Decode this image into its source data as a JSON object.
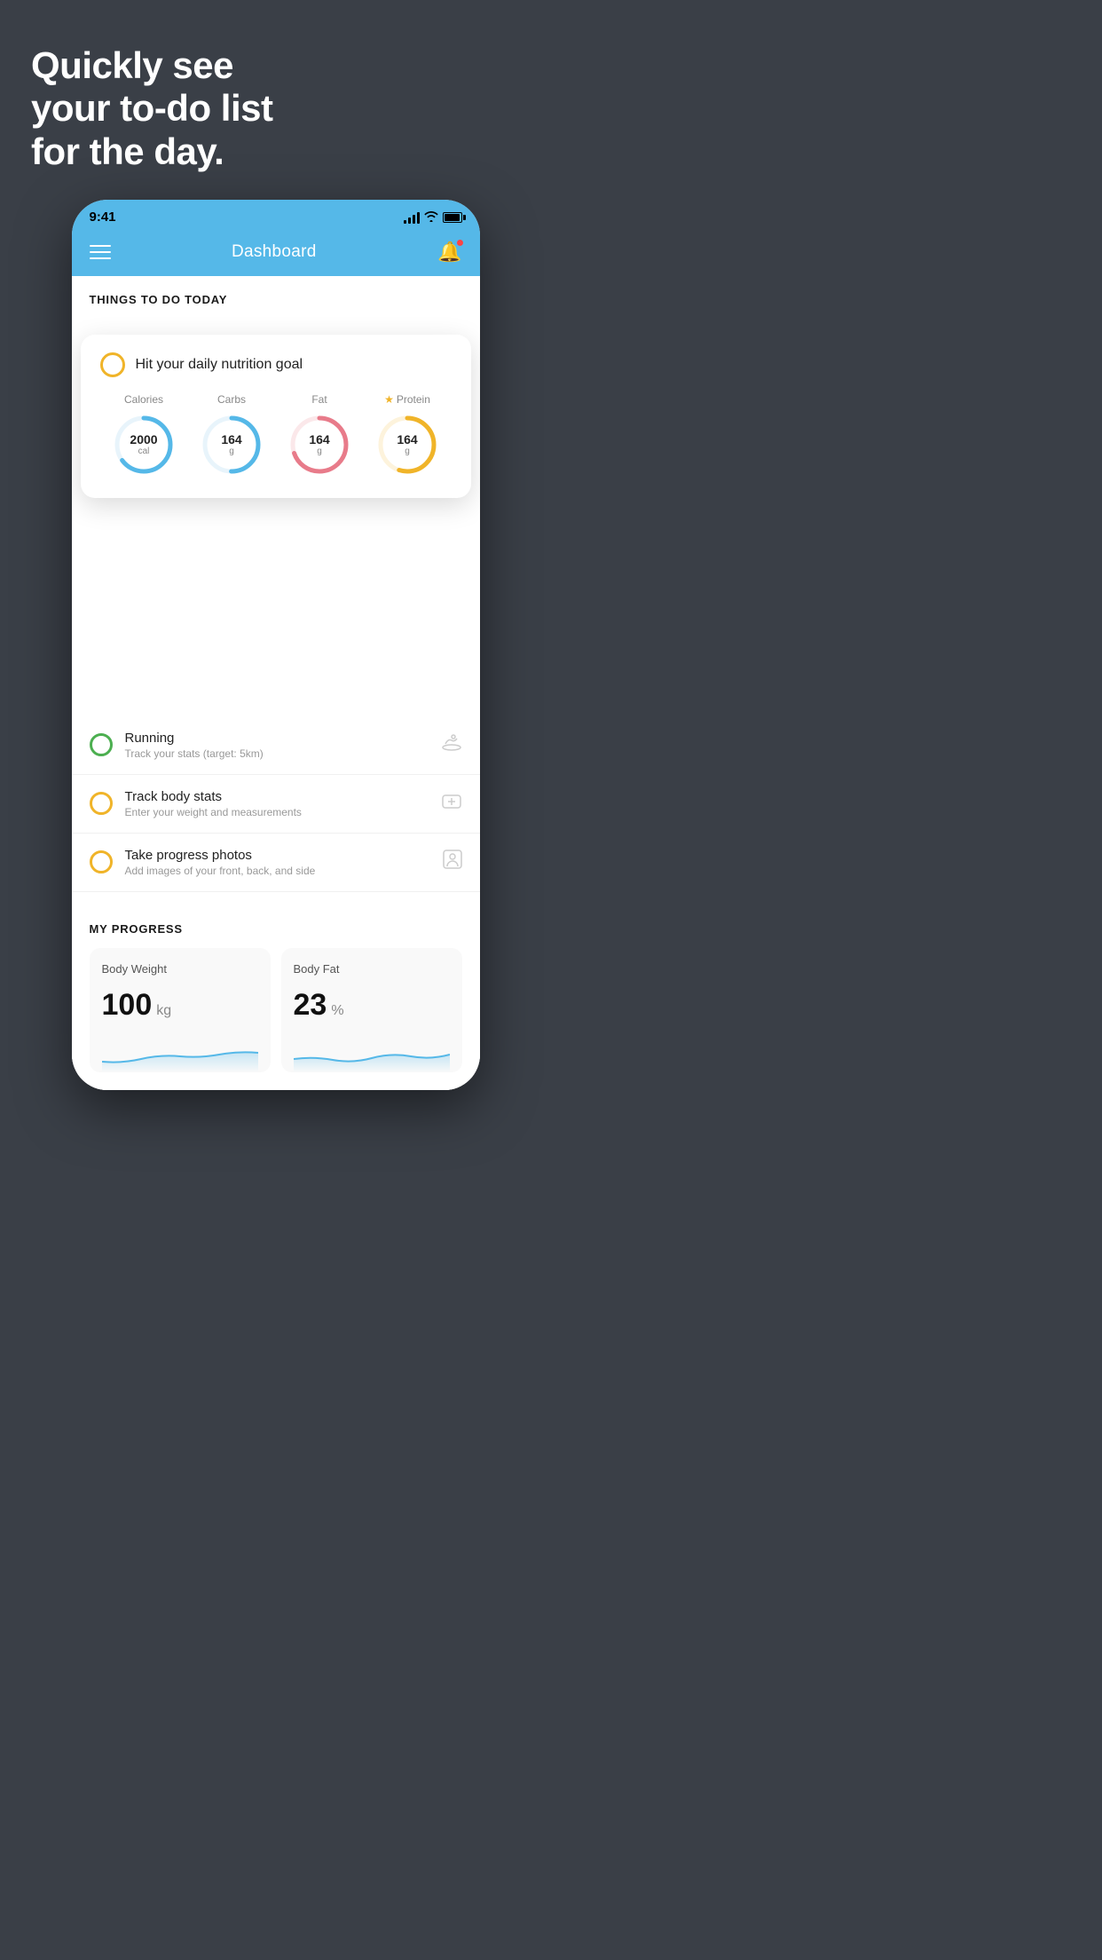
{
  "hero": {
    "title_line1": "Quickly see",
    "title_line2": "your to-do list",
    "title_line3": "for the day."
  },
  "phone": {
    "status": {
      "time": "9:41"
    },
    "header": {
      "title": "Dashboard"
    },
    "things_section": {
      "title": "THINGS TO DO TODAY"
    },
    "nutrition_card": {
      "title": "Hit your daily nutrition goal",
      "items": [
        {
          "label": "Calories",
          "value": "2000",
          "unit": "cal",
          "color": "#55b8e8",
          "pct": 65,
          "starred": false
        },
        {
          "label": "Carbs",
          "value": "164",
          "unit": "g",
          "color": "#55b8e8",
          "pct": 50,
          "starred": false
        },
        {
          "label": "Fat",
          "value": "164",
          "unit": "g",
          "color": "#e87b8a",
          "pct": 70,
          "starred": false
        },
        {
          "label": "Protein",
          "value": "164",
          "unit": "g",
          "color": "#f0b429",
          "pct": 55,
          "starred": true
        }
      ]
    },
    "tasks": [
      {
        "name": "Running",
        "sub": "Track your stats (target: 5km)",
        "circle_color": "green",
        "icon": "👟"
      },
      {
        "name": "Track body stats",
        "sub": "Enter your weight and measurements",
        "circle_color": "yellow",
        "icon": "⚖️"
      },
      {
        "name": "Take progress photos",
        "sub": "Add images of your front, back, and side",
        "circle_color": "yellow",
        "icon": "👤"
      }
    ],
    "progress": {
      "section_title": "MY PROGRESS",
      "cards": [
        {
          "label": "Body Weight",
          "value": "100",
          "unit": "kg"
        },
        {
          "label": "Body Fat",
          "value": "23",
          "unit": "%"
        }
      ]
    }
  }
}
